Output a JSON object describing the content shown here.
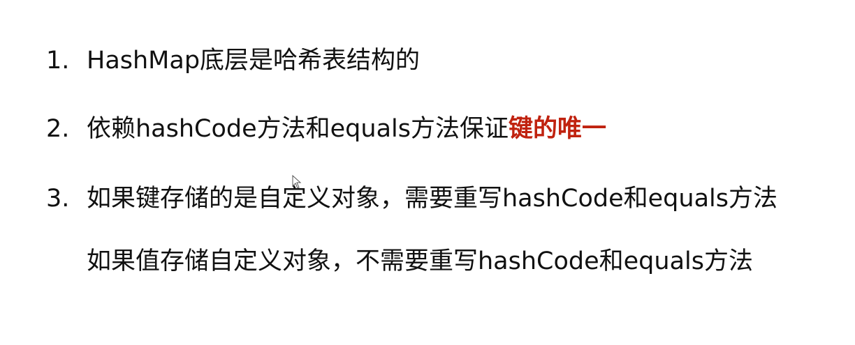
{
  "colors": {
    "text": "#111111",
    "highlight": "#c0220f",
    "background": "#ffffff"
  },
  "items": [
    {
      "number": "1.",
      "text": "HashMap底层是哈希表结构的"
    },
    {
      "number": "2.",
      "text": "依赖hashCode方法和equals方法保证",
      "highlight": "键的唯一"
    },
    {
      "number": "3.",
      "text": "如果键存储的是自定义对象，需要重写hashCode和equals方法",
      "continuation": "如果值存储自定义对象，不需要重写hashCode和equals方法"
    }
  ],
  "cursor_icon": "arrow-pointer-icon"
}
